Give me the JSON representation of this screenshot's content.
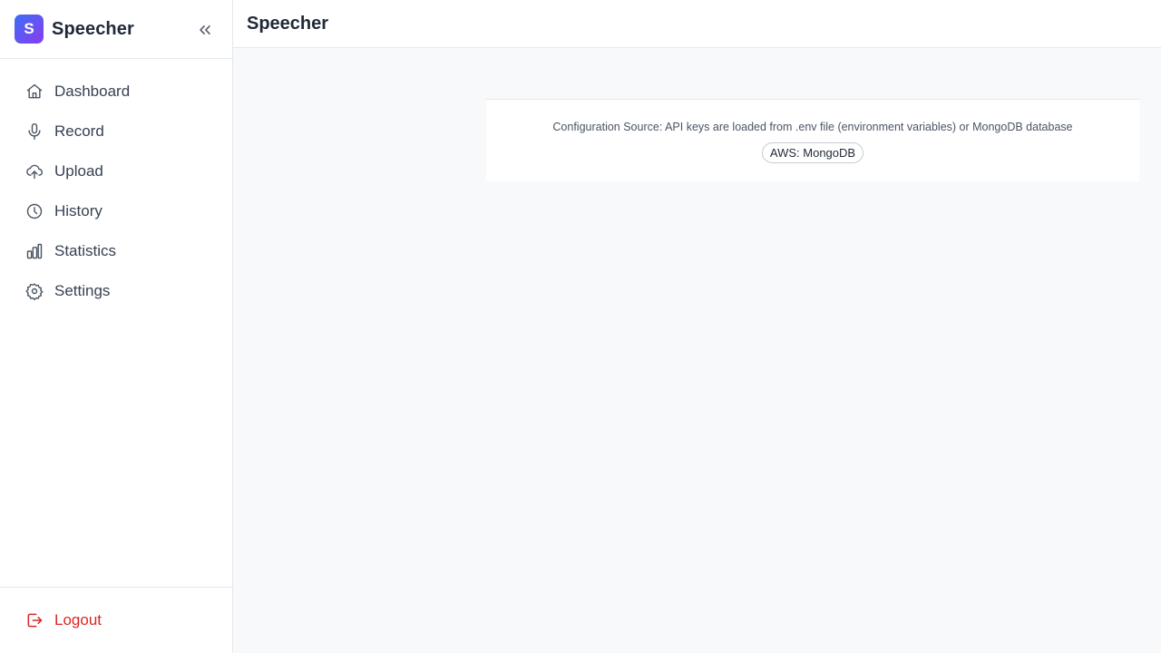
{
  "app": {
    "logo_letter": "S",
    "name": "Speecher"
  },
  "header": {
    "title": "Speecher"
  },
  "sidebar": {
    "items": [
      {
        "label": "Dashboard",
        "icon": "home-icon"
      },
      {
        "label": "Record",
        "icon": "microphone-icon"
      },
      {
        "label": "Upload",
        "icon": "upload-cloud-icon"
      },
      {
        "label": "History",
        "icon": "clock-icon"
      },
      {
        "label": "Statistics",
        "icon": "bar-chart-icon"
      },
      {
        "label": "Settings",
        "icon": "gear-icon"
      }
    ],
    "logout_label": "Logout"
  },
  "config": {
    "source_text": "Configuration Source: API keys are loaded from .env file (environment variables) or MongoDB database",
    "badge": "AWS: MongoDB"
  },
  "colors": {
    "accent_start": "#3b6ef5",
    "accent_end": "#8b3cf0",
    "danger": "#dc2626",
    "background": "#f8f9fb"
  }
}
